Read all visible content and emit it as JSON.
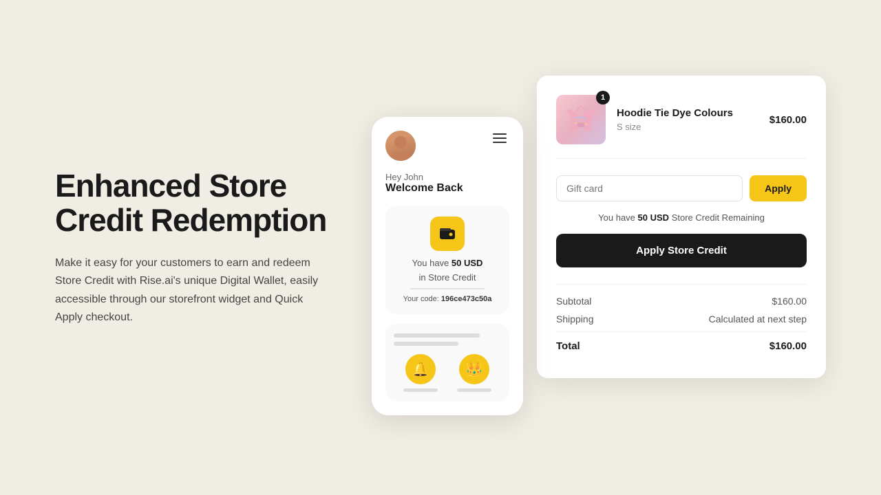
{
  "left": {
    "headline": "Enhanced Store Credit Redemption",
    "description": "Make it easy for your customers to earn and redeem Store Credit with Rise.ai's unique Digital Wallet, easily accessible through our storefront widget and Quick Apply checkout."
  },
  "mobile_widget": {
    "greeting_hey": "Hey John",
    "greeting_welcome": "Welcome Back",
    "credit_amount": "50 USD",
    "credit_suffix": "in Store Credit",
    "credit_have": "You have",
    "code_label": "Your code:",
    "code_value": "196ce473c50a"
  },
  "checkout": {
    "product_name": "Hoodie Tie Dye Colours",
    "product_size": "S size",
    "product_price": "$160.00",
    "product_badge": "1",
    "gift_card_placeholder": "Gift card",
    "apply_btn": "Apply",
    "store_credit_info_pre": "You have",
    "store_credit_amount": "50 USD",
    "store_credit_info_post": "Store Credit Remaining",
    "apply_store_credit_btn": "Apply Store Credit",
    "subtotal_label": "Subtotal",
    "subtotal_value": "$160.00",
    "shipping_label": "Shipping",
    "shipping_value": "Calculated at next step",
    "total_label": "Total",
    "total_value": "$160.00"
  }
}
